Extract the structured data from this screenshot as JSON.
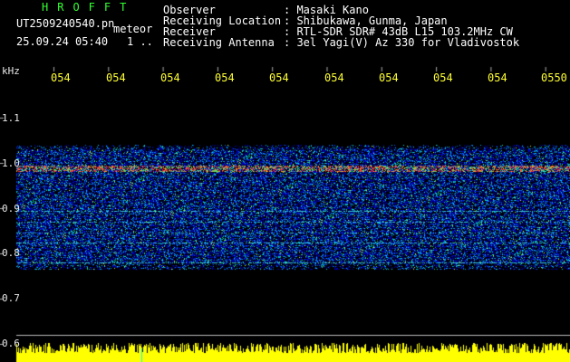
{
  "header": {
    "program": "HROFFT",
    "filename": "UT2509240540.pn",
    "meteor_label": "meteor",
    "datetime": "25.09.24 05:40",
    "count": "1 ..",
    "info_labels": [
      "Observer",
      "Receiving Location",
      "Receiver",
      "Receiving Antenna"
    ],
    "info_values": [
      ": Masaki Kano",
      ": Shibukawa, Gunma, Japan",
      ": RTL-SDR SDR# 43dB L15 103.2MHz CW",
      ": 3el Yagi(V) Az 330 for Vladivostok"
    ]
  },
  "axis": {
    "unit": "kHz",
    "y_ticks": [
      "1.1",
      "1.0",
      "0.9",
      "0.8",
      "0.7",
      "0.6"
    ],
    "x_ticks": [
      "054",
      "054",
      "054",
      "054",
      "054",
      "054",
      "054",
      "054",
      "054",
      "0550"
    ]
  },
  "colors": {
    "background": "#000000",
    "text": "#ffffff",
    "title": "#33ff33",
    "time_labels": "#ffff33",
    "amplitude": "#ffff00"
  }
}
